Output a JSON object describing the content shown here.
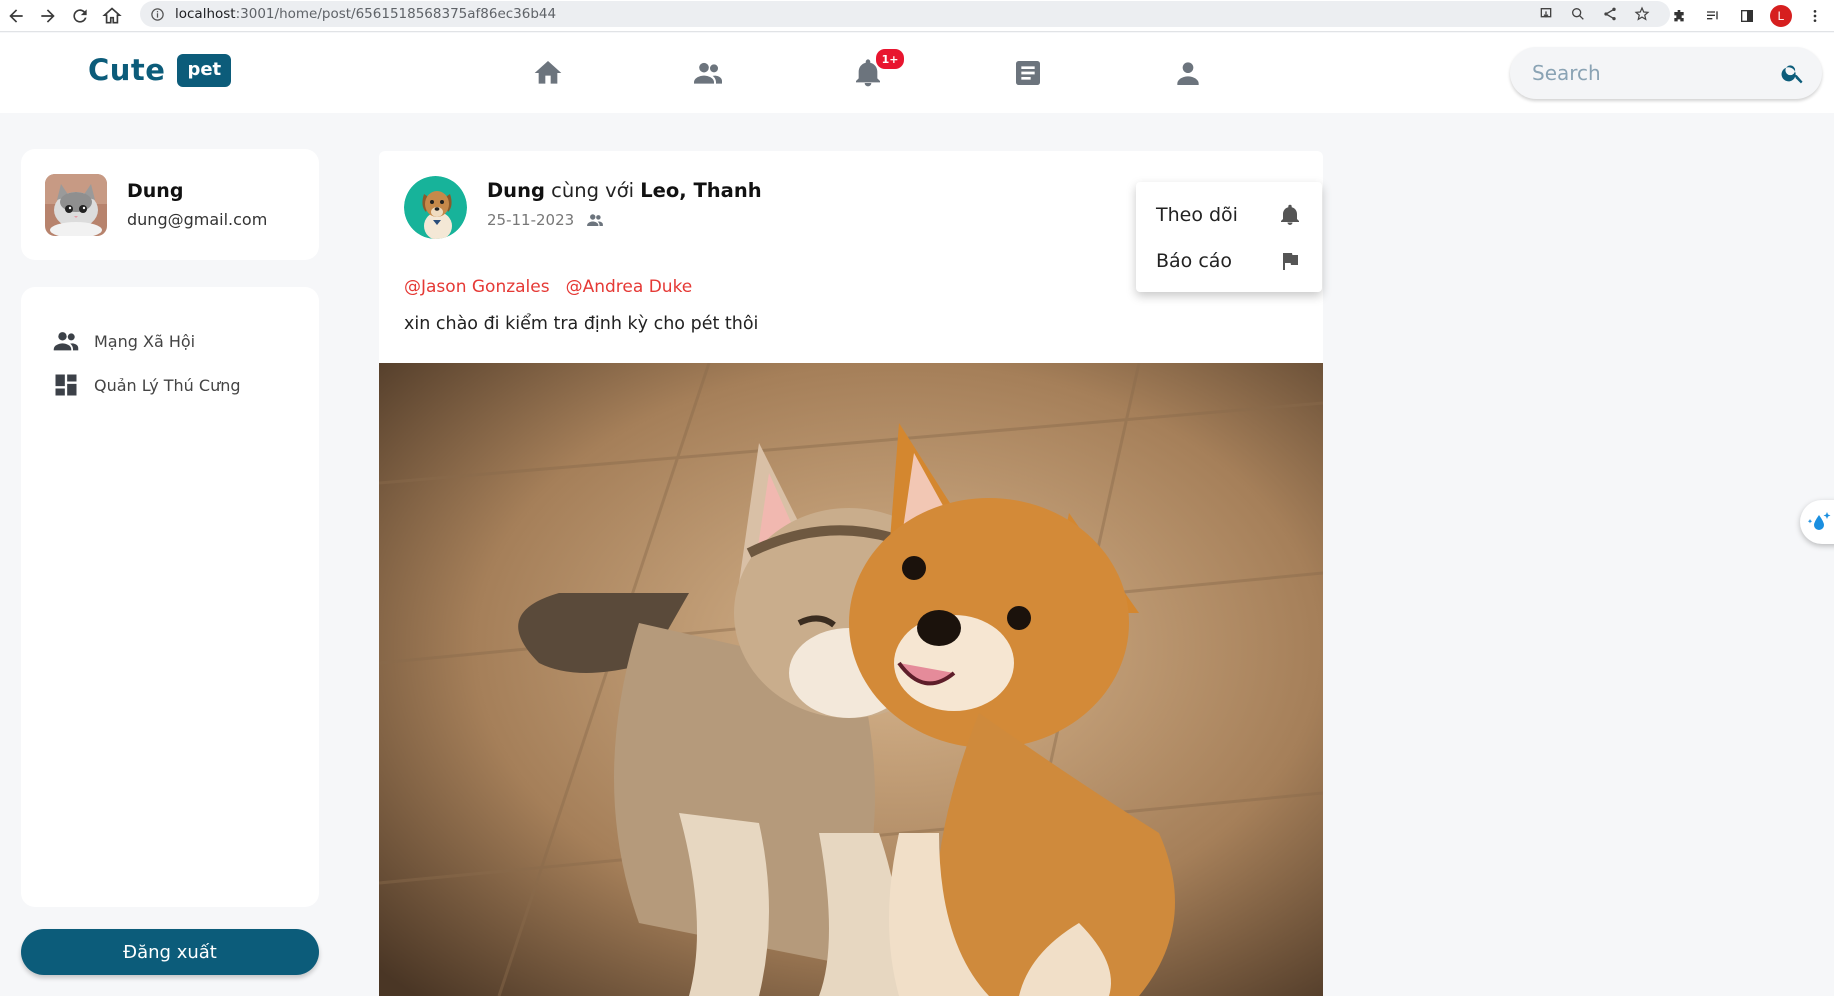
{
  "browser": {
    "url_host": "localhost",
    "url_path": ":3001/home/post/6561518568375af86ec36b44",
    "profile_initial": "L"
  },
  "header": {
    "logo_text": "Cute",
    "logo_badge": "pet",
    "nav_icons": [
      "home-icon",
      "friends-icon",
      "bell-icon",
      "article-icon",
      "person-icon"
    ],
    "notification_badge": "1+",
    "search_placeholder": "Search"
  },
  "sidebar": {
    "user_name": "Dung",
    "user_email": "dung@gmail.com",
    "menu_items": [
      {
        "label": "Mạng Xã Hội",
        "icon": "group-icon"
      },
      {
        "label": "Quản Lý Thú Cưng",
        "icon": "dashboard-icon"
      }
    ],
    "logout_label": "Đăng xuất"
  },
  "post": {
    "author": "Dung",
    "with_text": "cùng với",
    "tagged_names": "Leo, Thanh",
    "date": "25-11-2023",
    "tags": [
      "@Jason Gonzales",
      "@Andrea Duke"
    ],
    "content": "xin chào đi kiểm tra định kỳ cho pét thôi"
  },
  "dropdown": {
    "items": [
      {
        "label": "Theo dõi",
        "icon": "bell-icon"
      },
      {
        "label": "Báo cáo",
        "icon": "flag-icon"
      }
    ]
  },
  "colors": {
    "brand": "#0c5c7a",
    "tag": "#e53935",
    "badge": "#e8152f"
  }
}
